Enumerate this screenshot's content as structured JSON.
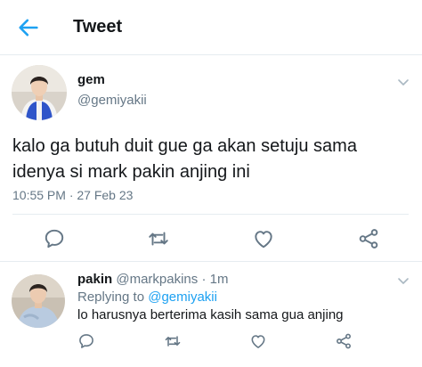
{
  "header": {
    "title": "Tweet",
    "back_icon": "arrow-left-icon",
    "accent_color": "#1da1f2"
  },
  "main_tweet": {
    "author_name": "gem",
    "author_handle": "@gemiyakii",
    "text": "kalo ga butuh duit gue ga akan setuju sama idenya si mark pakin anjing ini",
    "timestamp": "10:55 PM · 27 Feb 23",
    "actions": [
      "reply-icon",
      "retweet-icon",
      "like-icon",
      "share-icon"
    ]
  },
  "reply": {
    "author_name": "pakin",
    "author_handle": "@markpakins",
    "separator": "·",
    "time": "1m",
    "replying_prefix": "Replying to",
    "replying_to": "@gemiyakii",
    "text": "lo harusnya berterima kasih sama gua anjing",
    "actions": [
      "reply-icon",
      "retweet-icon",
      "like-icon",
      "share-icon"
    ]
  },
  "colors": {
    "text_primary": "#14171a",
    "text_secondary": "#657786",
    "divider": "#e6ecf0",
    "link": "#1da1f2"
  }
}
